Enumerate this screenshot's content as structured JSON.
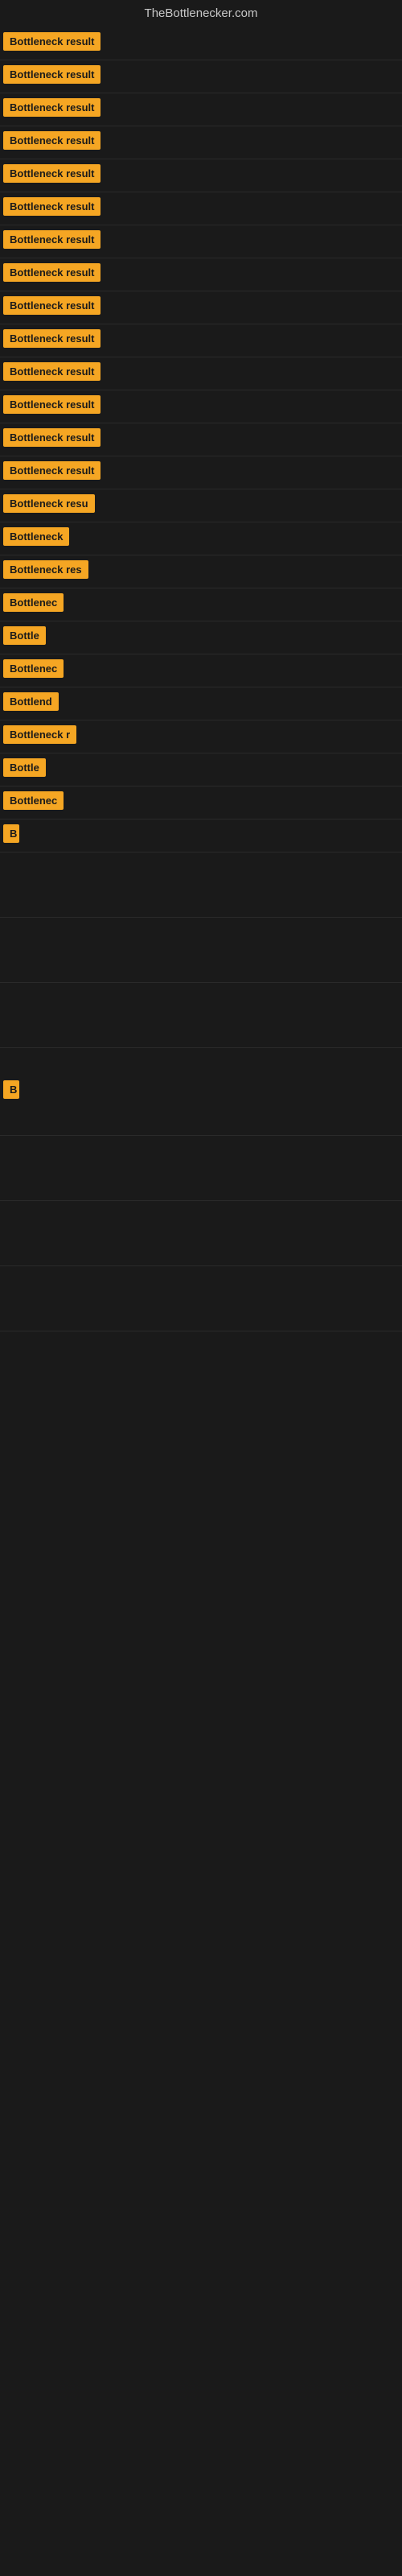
{
  "header": {
    "title": "TheBottlenecker.com"
  },
  "items": [
    {
      "id": 1,
      "label": "Bottleneck result",
      "badgeClass": "badge-full",
      "spacing": 12
    },
    {
      "id": 2,
      "label": "Bottleneck result",
      "badgeClass": "badge-full",
      "spacing": 12
    },
    {
      "id": 3,
      "label": "Bottleneck result",
      "badgeClass": "badge-full",
      "spacing": 12
    },
    {
      "id": 4,
      "label": "Bottleneck result",
      "badgeClass": "badge-full",
      "spacing": 12
    },
    {
      "id": 5,
      "label": "Bottleneck result",
      "badgeClass": "badge-full",
      "spacing": 12
    },
    {
      "id": 6,
      "label": "Bottleneck result",
      "badgeClass": "badge-full",
      "spacing": 12
    },
    {
      "id": 7,
      "label": "Bottleneck result",
      "badgeClass": "badge-full",
      "spacing": 12
    },
    {
      "id": 8,
      "label": "Bottleneck result",
      "badgeClass": "badge-full",
      "spacing": 12
    },
    {
      "id": 9,
      "label": "Bottleneck result",
      "badgeClass": "badge-full",
      "spacing": 12
    },
    {
      "id": 10,
      "label": "Bottleneck result",
      "badgeClass": "badge-full",
      "spacing": 12
    },
    {
      "id": 11,
      "label": "Bottleneck result",
      "badgeClass": "badge-full",
      "spacing": 12
    },
    {
      "id": 12,
      "label": "Bottleneck result",
      "badgeClass": "badge-full",
      "spacing": 12
    },
    {
      "id": 13,
      "label": "Bottleneck result",
      "badgeClass": "badge-full",
      "spacing": 12
    },
    {
      "id": 14,
      "label": "Bottleneck result",
      "badgeClass": "badge-full",
      "spacing": 12
    },
    {
      "id": 15,
      "label": "Bottleneck resu",
      "badgeClass": "badge-truncated-1",
      "spacing": 12
    },
    {
      "id": 16,
      "label": "Bottleneck",
      "badgeClass": "badge-truncated-2",
      "spacing": 12
    },
    {
      "id": 17,
      "label": "Bottleneck res",
      "badgeClass": "badge-truncated-1",
      "spacing": 12
    },
    {
      "id": 18,
      "label": "Bottlenec",
      "badgeClass": "badge-truncated-2",
      "spacing": 12
    },
    {
      "id": 19,
      "label": "Bottle",
      "badgeClass": "badge-truncated-3",
      "spacing": 12
    },
    {
      "id": 20,
      "label": "Bottlenec",
      "badgeClass": "badge-truncated-2",
      "spacing": 12
    },
    {
      "id": 21,
      "label": "Bottlend",
      "badgeClass": "badge-truncated-3",
      "spacing": 12
    },
    {
      "id": 22,
      "label": "Bottleneck r",
      "badgeClass": "badge-truncated-2",
      "spacing": 12
    },
    {
      "id": 23,
      "label": "Bottle",
      "badgeClass": "badge-truncated-3",
      "spacing": 12
    },
    {
      "id": 24,
      "label": "Bottlenec",
      "badgeClass": "badge-truncated-2",
      "spacing": 12
    },
    {
      "id": 25,
      "label": "B",
      "badgeClass": "badge-truncated-7",
      "spacing": 12
    },
    {
      "id": 26,
      "label": "",
      "badgeClass": "badge-truncated-8",
      "spacing": 80
    },
    {
      "id": 27,
      "label": "",
      "badgeClass": "badge-truncated-8",
      "spacing": 80
    },
    {
      "id": 28,
      "label": "",
      "badgeClass": "badge-truncated-8",
      "spacing": 80
    },
    {
      "id": 29,
      "label": "B",
      "badgeClass": "badge-truncated-7",
      "spacing": 80
    },
    {
      "id": 30,
      "label": "",
      "badgeClass": "badge-truncated-8",
      "spacing": 80
    },
    {
      "id": 31,
      "label": "",
      "badgeClass": "badge-truncated-8",
      "spacing": 80
    },
    {
      "id": 32,
      "label": "",
      "badgeClass": "badge-truncated-8",
      "spacing": 80
    }
  ],
  "colors": {
    "background": "#1a1a1a",
    "badgeBg": "#f5a623",
    "badgeText": "#1a1a1a",
    "headerText": "#c8c8c8"
  }
}
